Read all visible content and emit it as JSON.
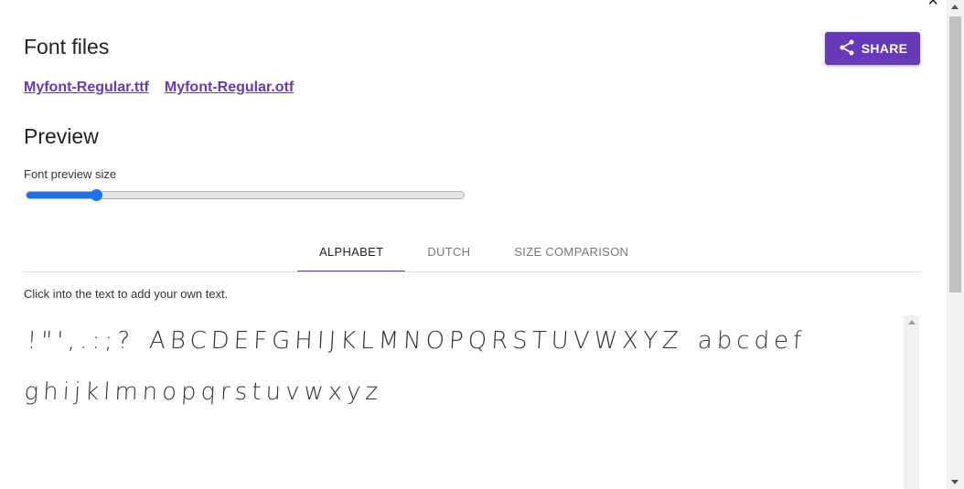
{
  "dialog": {
    "close_glyph": "×"
  },
  "font_files": {
    "title": "Font files",
    "links": [
      "Myfont-Regular.ttf",
      "Myfont-Regular.otf"
    ]
  },
  "share": {
    "label": "SHARE",
    "icon": "share-icon",
    "color": "#673ab7"
  },
  "preview": {
    "title": "Preview",
    "slider_label": "Font preview size",
    "slider_value": 0.16,
    "accent": "#1a73e8"
  },
  "tabs": [
    {
      "label": "ALPHABET",
      "active": true
    },
    {
      "label": "DUTCH",
      "active": false
    },
    {
      "label": "SIZE COMPARISON",
      "active": false
    }
  ],
  "hint": "Click into the text to add your own text.",
  "sample_text": "!\"',.:;? ABCDEFGHIJKLMNOPQRSTUVWXYZ abcdef ghijklmnopqrstuvwxyz"
}
